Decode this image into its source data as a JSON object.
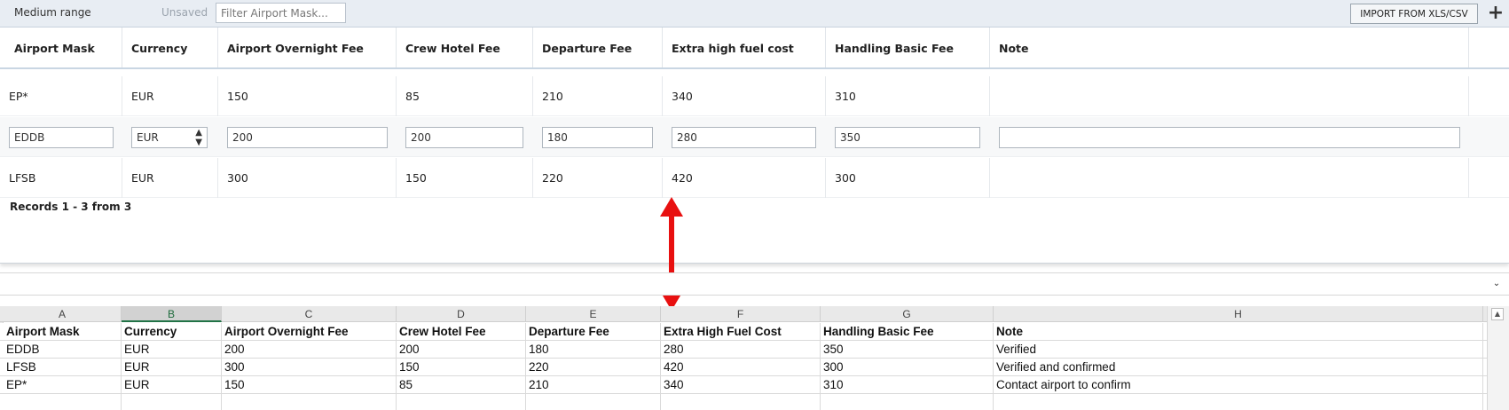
{
  "toolbar": {
    "title": "Medium range",
    "status": "Unsaved",
    "filter_placeholder": "Filter Airport Mask...",
    "import_label": "IMPORT FROM XLS/CSV",
    "add_label": "+"
  },
  "grid": {
    "columns": [
      "Airport Mask",
      "Currency",
      "Airport Overnight Fee",
      "Crew Hotel Fee",
      "Departure Fee",
      "Extra high fuel cost",
      "Handling Basic Fee",
      "Note"
    ],
    "rows": [
      [
        "EP*",
        "EUR",
        "150",
        "85",
        "210",
        "340",
        "310",
        ""
      ],
      [
        "EDDB",
        "EUR",
        "200",
        "200",
        "180",
        "280",
        "350",
        ""
      ],
      [
        "LFSB",
        "EUR",
        "300",
        "150",
        "220",
        "420",
        "300",
        ""
      ]
    ],
    "records_text": "Records 1 - 3 from 3"
  },
  "excel": {
    "column_letters": [
      "A",
      "B",
      "C",
      "D",
      "E",
      "F",
      "G",
      "H"
    ],
    "active_column": "B",
    "rows": [
      [
        "Airport Mask",
        "Currency",
        "Airport Overnight Fee",
        "Crew Hotel Fee",
        "Departure Fee",
        "Extra High Fuel Cost",
        "Handling Basic Fee",
        "Note"
      ],
      [
        "EDDB",
        "EUR",
        "200",
        "200",
        "180",
        "280",
        "350",
        "Verified"
      ],
      [
        "LFSB",
        "EUR",
        "300",
        "150",
        "220",
        "420",
        "300",
        "Verified and confirmed"
      ],
      [
        "EP*",
        "EUR",
        "150",
        "85",
        "210",
        "340",
        "310",
        "Contact airport to confirm"
      ],
      [
        "",
        "",
        "",
        "",
        "",
        "",
        "",
        ""
      ]
    ]
  },
  "colors": {
    "arrow": "#e81010",
    "excel_accent": "#217346",
    "toolbar_bg": "#e8edf3"
  },
  "icons": {
    "select_arrows": "up-down-chevron-icon",
    "formula_dropdown": "chevron-down-icon",
    "scroll_up": "scroll-up-icon"
  }
}
